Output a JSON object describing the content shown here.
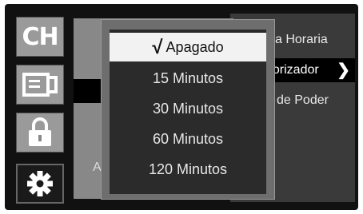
{
  "right_menu": {
    "items": [
      {
        "label": "a Horaria"
      },
      {
        "label": "porizador"
      },
      {
        "label": "de Poder"
      }
    ]
  },
  "background_label": "A",
  "sidebar": {
    "icons": [
      {
        "label": "CH"
      },
      {
        "icon": "input-source-icon"
      },
      {
        "icon": "lock-icon"
      },
      {
        "icon": "gear-icon"
      }
    ]
  },
  "popup": {
    "options": [
      {
        "label": "Apagado",
        "checked": true
      },
      {
        "label": "15 Minutos"
      },
      {
        "label": "30 Minutos"
      },
      {
        "label": "60 Minutos"
      },
      {
        "label": "120 Minutos"
      }
    ]
  },
  "colors": {
    "screen_bg": "#111111",
    "highlight_bg": "#f2f2f2",
    "panel_gray": "#888888"
  }
}
